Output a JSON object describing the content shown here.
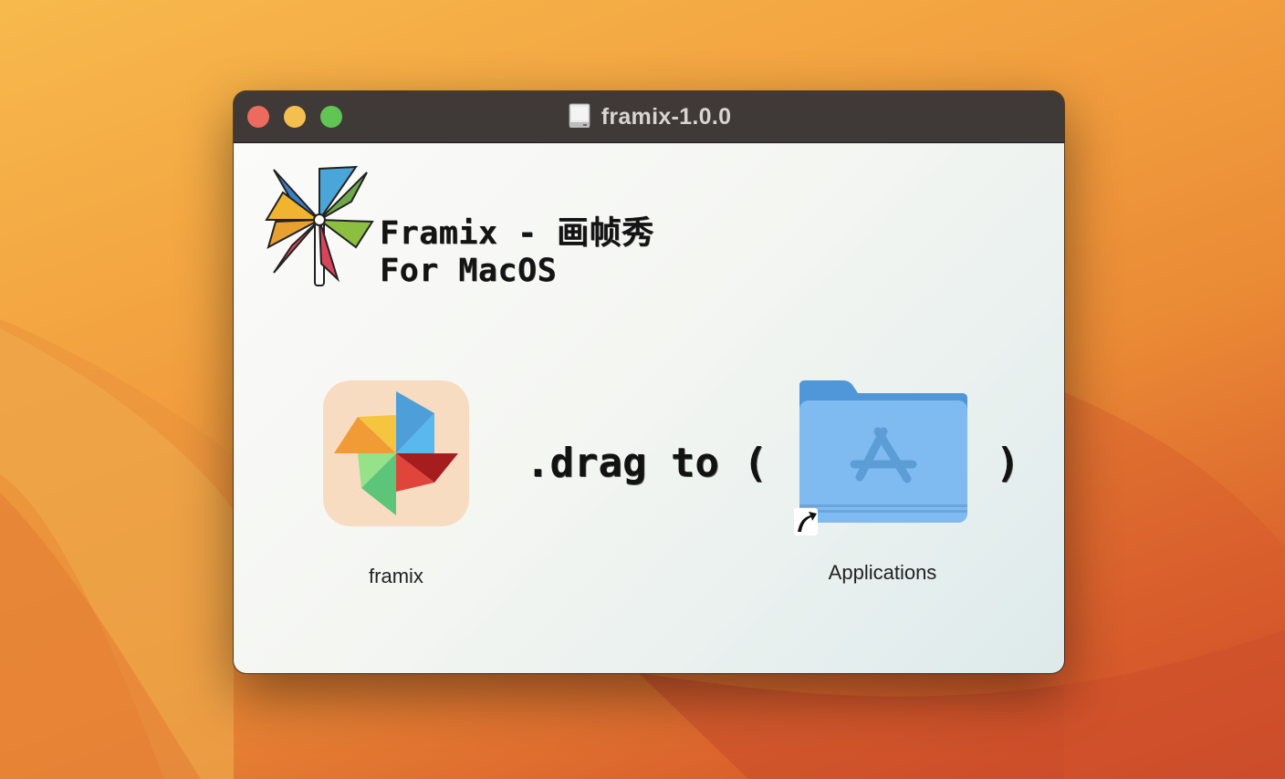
{
  "window": {
    "title": "framix-1.0.0"
  },
  "brand": {
    "line1": "Framix - 画帧秀",
    "line2": "For MacOS"
  },
  "items": {
    "app_label": "framix",
    "drag_text": ".drag to (",
    "drag_close": ")",
    "folder_label": "Applications"
  },
  "icons": {
    "close": "traffic-light-close",
    "minimize": "traffic-light-minimize",
    "zoom": "traffic-light-zoom",
    "disk": "disk-image-icon",
    "logo": "pinwheel-logo",
    "app": "pinwheel-app-icon",
    "folder": "applications-folder-icon",
    "alias": "alias-arrow-icon"
  },
  "colors": {
    "close": "#ed6a5e",
    "minimize": "#f5bf4f",
    "zoom": "#61c554",
    "titlebar": "#3f3938",
    "folder": "#7fb9ef"
  }
}
